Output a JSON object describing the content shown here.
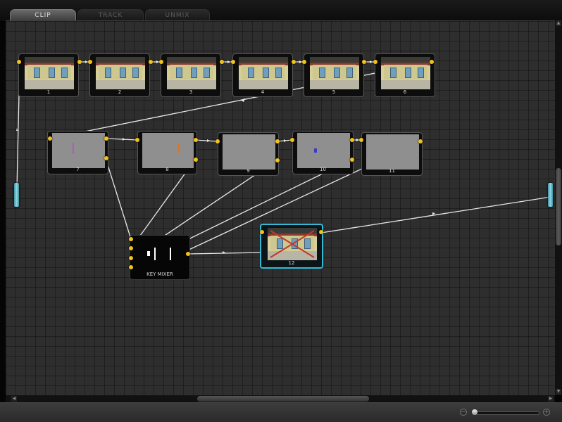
{
  "tabs": [
    {
      "label": "CLIP",
      "active": true
    },
    {
      "label": "TRACK",
      "active": false
    },
    {
      "label": "UNMIX",
      "active": false
    }
  ],
  "colors": {
    "port": "#f2c21a",
    "wire": "#e8e8e8",
    "selection": "#38b9d3",
    "cross": "#c0392b",
    "canvas": "#2e2e2e"
  },
  "source_nodes": [
    {
      "label": "1"
    },
    {
      "label": "2"
    },
    {
      "label": "3"
    },
    {
      "label": "4"
    },
    {
      "label": "5"
    },
    {
      "label": "6"
    }
  ],
  "process_nodes": [
    {
      "label": "7"
    },
    {
      "label": "8"
    },
    {
      "label": "9"
    },
    {
      "label": "10"
    },
    {
      "label": "11"
    }
  ],
  "key_mixer": {
    "label": "KEY MIXER"
  },
  "output_node": {
    "label": "12"
  },
  "icons": {
    "zoom_out": "zoom-out-icon",
    "zoom_in": "zoom-in-icon"
  },
  "zoom": {
    "level": 0.0
  }
}
